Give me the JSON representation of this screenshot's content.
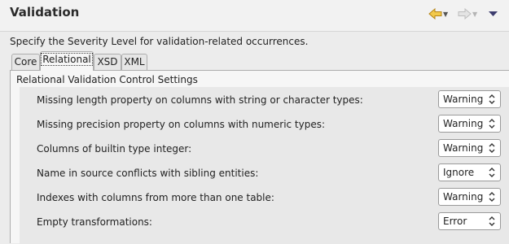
{
  "page": {
    "title": "Validation",
    "description": "Specify the Severity Level for validation-related occurrences."
  },
  "toolbar": {
    "back_icon": "back-arrow-icon",
    "forward_icon": "forward-arrow-icon",
    "menu_icon": "view-menu-icon",
    "accent_color": "#e8b32a"
  },
  "tabs": [
    {
      "label": "Core",
      "active": false
    },
    {
      "label": "Relational",
      "active": true
    },
    {
      "label": "XSD",
      "active": false
    },
    {
      "label": "XML",
      "active": false
    }
  ],
  "group": {
    "label": "Relational Validation Control Settings",
    "rows": [
      {
        "label": "Missing length property on columns with string or character types:",
        "value": "Warning"
      },
      {
        "label": "Missing precision property on columns with numeric types:",
        "value": "Warning"
      },
      {
        "label": "Columns of builtin type integer:",
        "value": "Warning"
      },
      {
        "label": "Name in source conflicts with sibling entities:",
        "value": "Ignore"
      },
      {
        "label": "Indexes with columns from more than one table:",
        "value": "Warning"
      },
      {
        "label": "Empty transformations:",
        "value": "Error"
      }
    ]
  }
}
